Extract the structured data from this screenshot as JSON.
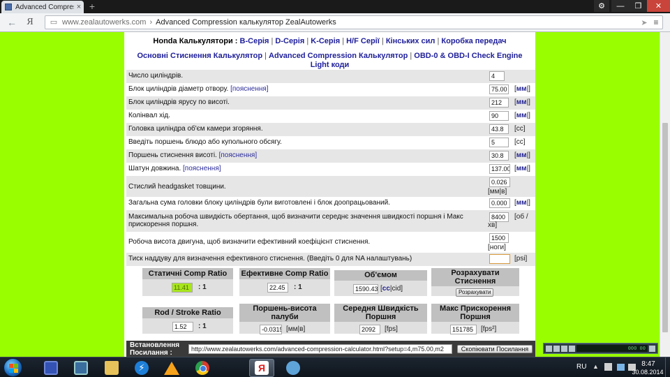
{
  "browser": {
    "tab_title": "Advanced Compressic",
    "tab_close": "×",
    "new_tab": "+",
    "url_host": "www.zealautowerks.com",
    "url_sep": "›",
    "url_title": "Advanced Compression калькулятор ZealAutowerks",
    "nav_back": "←",
    "nav_ya": "Я"
  },
  "nav": {
    "line1_prefix": "Honda Калькулятори :",
    "line1_links": [
      "B-Серія",
      "D-Серія",
      "K-Серія",
      "H/F Серії",
      "Кінських сил",
      "Коробка передач"
    ],
    "line2_links": [
      "Основні Стиснення Калькулятор",
      "Advanced Compression Калькулятор",
      "OBD-0 & OBD-I Check Engine Light коди"
    ]
  },
  "form": {
    "hint": "[пояснення]",
    "rows": [
      {
        "label": "Число циліндрів.",
        "value": "4",
        "unit": ""
      },
      {
        "label": "Блок циліндрів діаметр отвору.",
        "value": "75.00",
        "unit_pre": "[",
        "unit_bold": "мм",
        "unit_post": "|]"
      },
      {
        "label": "Блок циліндрів ярусу по висоті.",
        "value": "212",
        "unit_pre": "[",
        "unit_bold": "мм",
        "unit_post": "|]"
      },
      {
        "label": "Колінвал хід.",
        "value": "90",
        "unit_pre": "[",
        "unit_bold": "мм",
        "unit_post": "|]"
      },
      {
        "label": "Головка циліндра об'єм камери згоряння.",
        "value": "43.8",
        "unit": "[cc]"
      },
      {
        "label": "Введіть поршень блюдо або купольного обсягу.",
        "value": "5",
        "unit": "[cc]"
      },
      {
        "label": "Поршень стиснення висоті.",
        "value": "30.8",
        "unit_pre": "[",
        "unit_bold": "мм",
        "unit_post": "|]"
      },
      {
        "label": "Шатун довжина.",
        "value": "137.00",
        "unit_pre": "[",
        "unit_bold": "мм",
        "unit_post": "|]"
      },
      {
        "label": "Стислий headgasket товщини.",
        "value": "0.026",
        "unit": "[мм|в]"
      },
      {
        "label": "Загальна сума головки блоку циліндрів були виготовлені і блок доопрацьований.",
        "value": "0.000",
        "unit_pre": "[",
        "unit_bold": "мм",
        "unit_post": "|]"
      },
      {
        "label_line1": "Максимальна робоча швидкість обертання, щоб визначити середнє значення швидкості поршня і Макс",
        "label_line2": "прискорення поршня.",
        "value": "8400",
        "unit_line1": "[об /",
        "unit_line2": "хв]"
      },
      {
        "label": "Робоча висота двигуна, щоб визначити ефективний коефіцієнт стиснення.",
        "value": "1500",
        "unit": "[ноги]"
      },
      {
        "label": "Тиск наддуву для визначення ефективного стиснення. (Введіть 0 для NA налаштувань)",
        "value": "",
        "unit": "[psi]"
      }
    ]
  },
  "results": {
    "static_cr": {
      "title": "Статичні Comp Ratio",
      "value": "11.41",
      "suffix": ": 1"
    },
    "effective_cr": {
      "title": "Ефективне Comp Ratio",
      "value": "22.45",
      "suffix": ": 1"
    },
    "volume": {
      "title": "Об'ємом",
      "value": "1590.43",
      "unit_pre": "[",
      "unit_bold": "cc",
      "unit_post": "|cid]"
    },
    "calculate": {
      "title_line1": "Розрахувати",
      "title_line2": "Стиснення",
      "button": "Розрахувати"
    },
    "rod_stroke": {
      "title": "Rod / Stroke Ratio",
      "value": "1.52",
      "suffix": ": 1"
    },
    "deck": {
      "title_line1": "Поршень-висота",
      "title_line2": "палуби",
      "value": "-0.0315",
      "unit": "[мм|в]"
    },
    "piston_speed": {
      "title_line1": "Середня Швидкість",
      "title_line2": "Поршня",
      "value": "2092",
      "unit": "[fps]"
    },
    "piston_accel": {
      "title_line1": "Макс Прискорення",
      "title_line2": "Поршня",
      "value": "151785",
      "unit": "[fps²]"
    }
  },
  "setup": {
    "label_line1": "Встановлення",
    "label_line2": "Посилання :",
    "url": "http://www.zealautowerks.com/advanced-compression-calculator.html?setup=4,m75.00,m2",
    "copy_button": "Скопіювати Посилання"
  },
  "media": {
    "screen": "000 00"
  },
  "taskbar": {
    "lang": "RU",
    "time": "8:47",
    "date": "30.08.2014"
  },
  "icons": [
    "tab-favicon",
    "back-arrow-icon",
    "page-icon",
    "share-icon",
    "menu-icon",
    "settings-icon",
    "start-icon",
    "save-icon",
    "computer-icon",
    "folder-icon",
    "lightning-icon",
    "warning-icon",
    "chrome-icon",
    "yandex-icon",
    "tool-icon"
  ]
}
